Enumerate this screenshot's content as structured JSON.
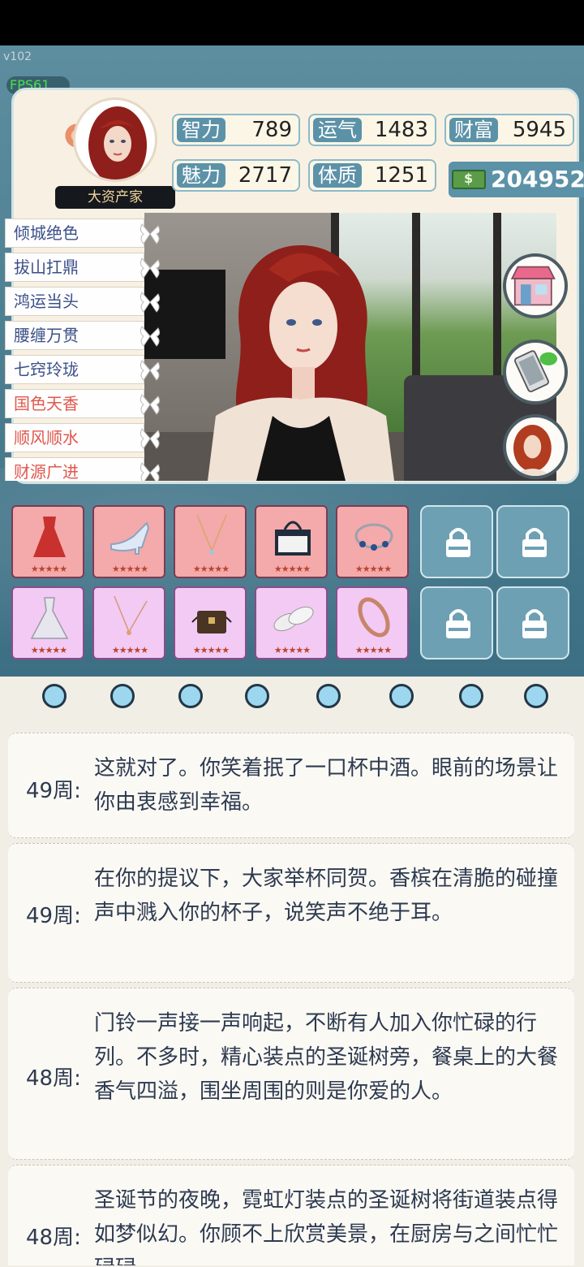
{
  "app": {
    "version": "v102",
    "fps": "FPS61"
  },
  "profile": {
    "title_badge": "大资产家"
  },
  "stats": [
    {
      "label": "智力",
      "value": "789"
    },
    {
      "label": "运气",
      "value": "1483"
    },
    {
      "label": "财富",
      "value": "5945"
    },
    {
      "label": "魅力",
      "value": "2717"
    },
    {
      "label": "体质",
      "value": "1251"
    }
  ],
  "money": {
    "value": "204952",
    "icon": "cash-icon"
  },
  "traits": [
    {
      "label": "倾城绝色",
      "color": "#3b4f88"
    },
    {
      "label": "拔山扛鼎",
      "color": "#3b4f88"
    },
    {
      "label": "鸿运当头",
      "color": "#3b4f88"
    },
    {
      "label": "腰缠万贯",
      "color": "#3b4f88"
    },
    {
      "label": "七窍玲珑",
      "color": "#3b4f88"
    },
    {
      "label": "国色天香",
      "color": "#e0574d"
    },
    {
      "label": "顺风顺水",
      "color": "#e0574d"
    },
    {
      "label": "财源广进",
      "color": "#e0574d"
    }
  ],
  "side_buttons": {
    "shop_label": "商店"
  },
  "inventory": {
    "row1": [
      {
        "name": "red-dress",
        "stars": "★★★★★"
      },
      {
        "name": "crystal-heels",
        "stars": "★★★★★"
      },
      {
        "name": "gold-necklace",
        "stars": "★★★★★"
      },
      {
        "name": "handbag",
        "stars": "★★★★★"
      },
      {
        "name": "charm-bracelet",
        "stars": "★★★★★"
      }
    ],
    "row2": [
      {
        "name": "white-gown",
        "stars": "★★★★★"
      },
      {
        "name": "pendant-necklace",
        "stars": "★★★★★"
      },
      {
        "name": "trunk-bag",
        "stars": "★★★★★"
      },
      {
        "name": "white-flats",
        "stars": "★★★★★"
      },
      {
        "name": "love-bangle",
        "stars": "★★★★★"
      }
    ]
  },
  "log": [
    {
      "week": "49周:",
      "text": "这就对了。你笑着抿了一口杯中酒。眼前的场景让你由衷感到幸福。"
    },
    {
      "week": "49周:",
      "text": "在你的提议下，大家举杯同贺。香槟在清脆的碰撞声中溅入你的杯子，说笑声不绝于耳。"
    },
    {
      "week": "48周:",
      "text": "门铃一声接一声响起，不断有人加入你忙碌的行列。不多时，精心装点的圣诞树旁，餐桌上的大餐香气四溢，围坐周围的则是你爱的人。"
    },
    {
      "week": "48周:",
      "text": "圣诞节的夜晚，霓虹灯装点的圣诞树将街道装点得如梦似幻。你顾不上欣赏美景，在厨房与之间忙忙碌碌。"
    }
  ]
}
